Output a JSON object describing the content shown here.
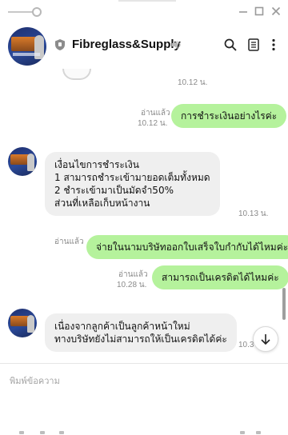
{
  "chat": {
    "name": "Fibreglass&Supply"
  },
  "messages": {
    "m1": {
      "time": "10.12 น."
    },
    "m2": {
      "read": "อ่านแล้ว",
      "time": "10.12 น.",
      "text": "การชำระเงินอย่างไรค่ะ"
    },
    "m3": {
      "lines": [
        "เงื่อนไขการชำระเงิน",
        "1 สามารถชำระเข้ามายอดเต็มทั้งหมด",
        "2 ชำระเข้ามาเป็นมัดจำ50%",
        "ส่วนที่เหลือเก็บหน้างาน"
      ],
      "time": "10.13 น."
    },
    "m4": {
      "read": "อ่านแล้ว",
      "text": "จ่ายในนามบริษัทออกใบเสร็จใบกำกับได้ไหมค่ะ"
    },
    "m5": {
      "read": "อ่านแล้ว",
      "time": "10.28 น.",
      "text": "สามารถเป็นเครดิตได้ไหมค่ะ"
    },
    "m6": {
      "lines": [
        "เนื่องจากลูกค้าเป็นลูกค้าหน้าใหม่",
        "ทางบริษัทยังไม่สามารถให้เป็นเครดิตได้ค่ะ"
      ],
      "time": "10.3"
    }
  },
  "input": {
    "placeholder": "พิมพ์ข้อความ"
  },
  "icons": {
    "shield": "shield-icon",
    "speaker": "speaker-muted-icon",
    "search": "search-icon",
    "notes": "notes-icon",
    "more": "more-vertical-icon",
    "scroll_down": "arrow-down-icon"
  },
  "colors": {
    "outgoing_bubble": "#b5f29c",
    "incoming_bubble": "#efefef",
    "meta_text": "#8a8a8a"
  }
}
